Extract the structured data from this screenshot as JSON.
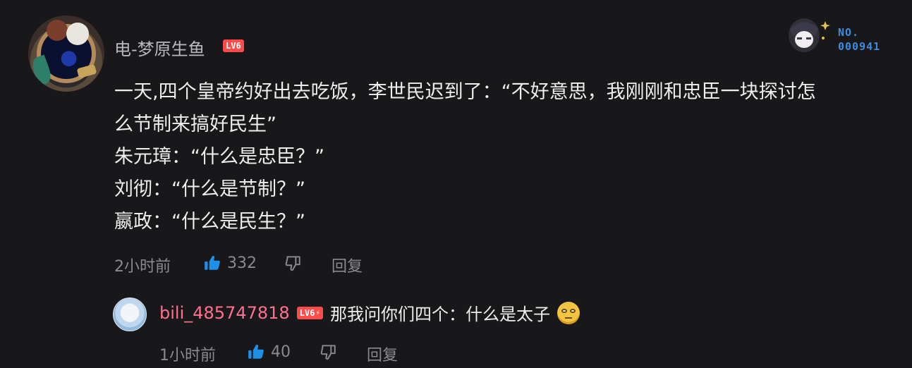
{
  "comment": {
    "username": "电-梦原生鱼",
    "level_badge": "LV6",
    "decoration_label": "NO.",
    "decoration_number": "000941",
    "lines": [
      "一天,四个皇帝约好出去吃饭，李世民迟到了：“不好意思，我刚刚和忠臣一块探讨怎",
      "么节制来搞好民生”",
      "朱元璋：“什么是忠臣？”",
      "刘彻：“什么是节制？”",
      "嬴政：“什么是民生？”"
    ],
    "time": "2小时前",
    "likes": "332",
    "reply_label": "回复",
    "colors": {
      "like_active": "#1e90e8",
      "level_badge": "#ff4a4a"
    }
  },
  "reply": {
    "username": "bili_485747818",
    "level_badge": "LV6",
    "text": "那我问你们四个：什么是太子",
    "emoji": "smug-emoji",
    "time": "1小时前",
    "likes": "40",
    "reply_label": "回复",
    "colors": {
      "username": "#ff6f8f"
    }
  }
}
